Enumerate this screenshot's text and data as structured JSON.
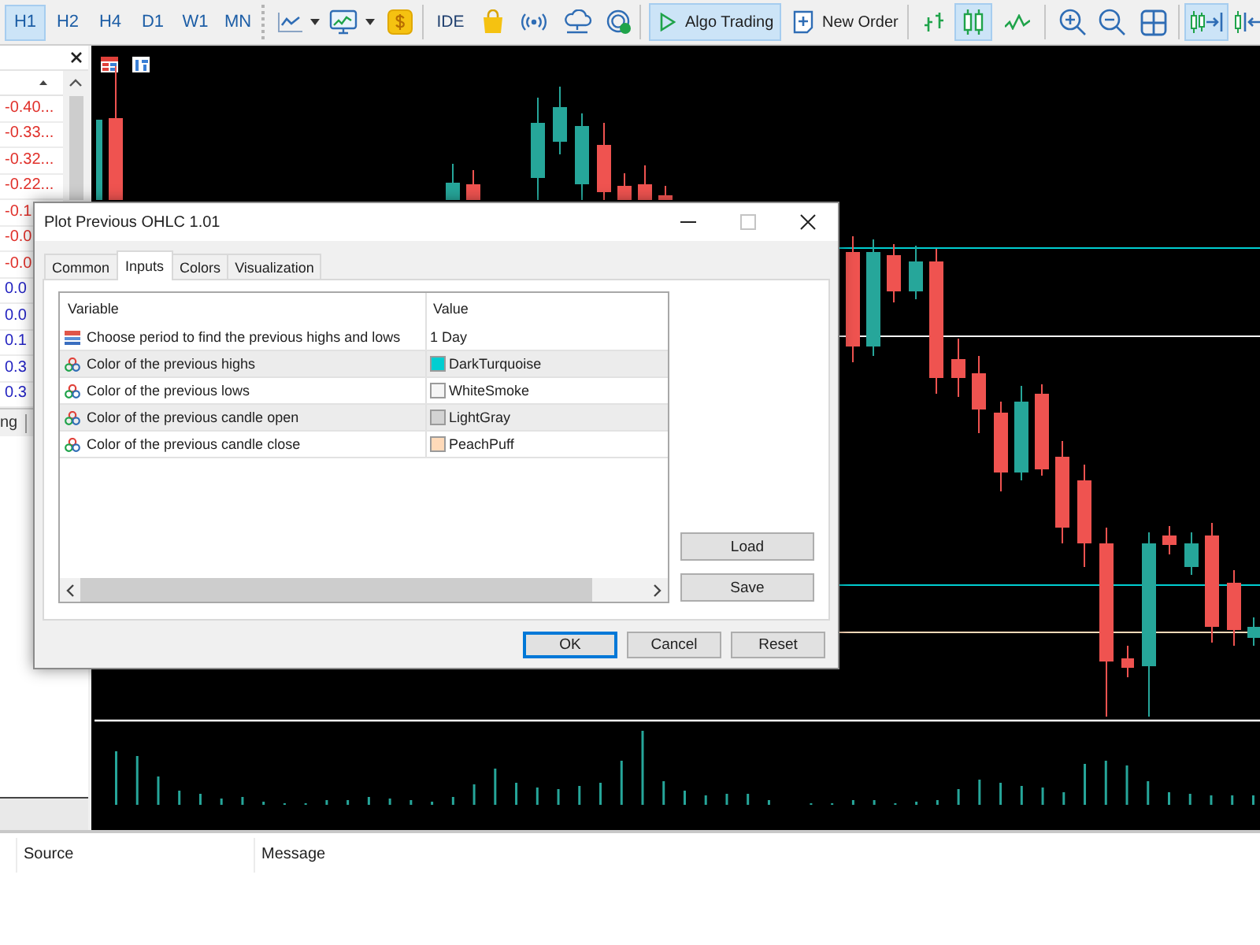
{
  "toolbar": {
    "timeframes": [
      {
        "label": "H1",
        "selected": true
      },
      {
        "label": "H2",
        "selected": false
      },
      {
        "label": "H4",
        "selected": false
      },
      {
        "label": "D1",
        "selected": false
      },
      {
        "label": "W1",
        "selected": false
      },
      {
        "label": "MN",
        "selected": false
      }
    ],
    "ide": "IDE",
    "algo_trading": {
      "label": "Algo Trading",
      "on": true
    },
    "new_order": "New Order",
    "chart_types": [
      {
        "kind": "bars",
        "selected": false
      },
      {
        "kind": "candles",
        "selected": true
      },
      {
        "kind": "line",
        "selected": false
      }
    ],
    "auto_scroll": {
      "on": true
    },
    "chart_shift": {
      "on": false
    }
  },
  "market_watch": {
    "rows": [
      {
        "value": "-0.40...",
        "color": "#e0302a"
      },
      {
        "value": "-0.33...",
        "color": "#e0302a"
      },
      {
        "value": "-0.32...",
        "color": "#e0302a"
      },
      {
        "value": "-0.22...",
        "color": "#e0302a"
      },
      {
        "value": "-0.1",
        "color": "#e0302a"
      },
      {
        "value": "-0.0",
        "color": "#e0302a"
      },
      {
        "value": "-0.0",
        "color": "#e0302a"
      },
      {
        "value": "0.0",
        "color": "#2222c0"
      },
      {
        "value": "0.0",
        "color": "#2222c0"
      },
      {
        "value": "0.1",
        "color": "#2222c0"
      },
      {
        "value": "0.3",
        "color": "#2222c0"
      },
      {
        "value": "0.3",
        "color": "#2222c0"
      }
    ],
    "tab_label": "ng"
  },
  "dialog": {
    "title": "Plot Previous OHLC 1.01",
    "tabs": [
      {
        "label": "Common",
        "selected": false
      },
      {
        "label": "Inputs",
        "selected": true
      },
      {
        "label": "Colors",
        "selected": false
      },
      {
        "label": "Visualization",
        "selected": false
      }
    ],
    "inputs": {
      "columns": [
        "Variable",
        "Value"
      ],
      "rows": [
        {
          "kind": "enum",
          "variable": "Choose period to find the previous highs and lows",
          "value": "1 Day"
        },
        {
          "kind": "color",
          "variable": "Color of the previous highs",
          "value": "DarkTurquoise",
          "color": "#00ced1"
        },
        {
          "kind": "color",
          "variable": "Color of the previous lows",
          "value": "WhiteSmoke",
          "color": "#f5f5f5"
        },
        {
          "kind": "color",
          "variable": "Color of the previous candle open",
          "value": "LightGray",
          "color": "#d3d3d3"
        },
        {
          "kind": "color",
          "variable": "Color of the previous candle close",
          "value": "PeachPuff",
          "color": "#ffdab9"
        }
      ]
    },
    "side_buttons": [
      "Load",
      "Save"
    ],
    "buttons": [
      {
        "label": "OK",
        "default": true
      },
      {
        "label": "Cancel",
        "default": false
      },
      {
        "label": "Reset",
        "default": false
      }
    ]
  },
  "journal": {
    "columns": [
      "Source",
      "Message"
    ]
  }
}
